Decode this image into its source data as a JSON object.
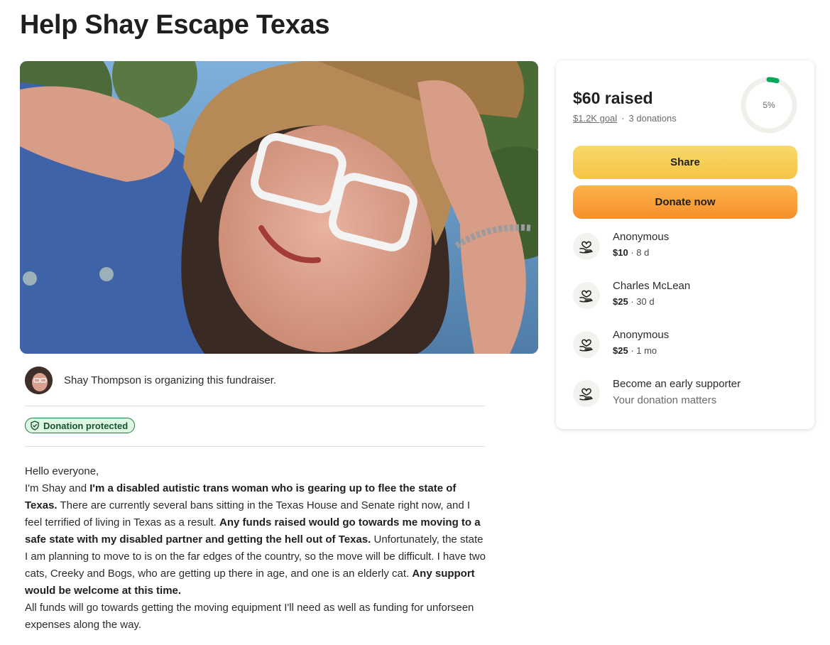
{
  "page": {
    "title": "Help Shay Escape Texas"
  },
  "organizer": {
    "text": "Shay Thompson is organizing this fundraiser."
  },
  "badge": {
    "label": "Donation protected"
  },
  "story": {
    "line1": "Hello everyone,",
    "p2_a": "I'm Shay and ",
    "p2_b": "I'm a disabled autistic trans woman who is gearing up to flee the state of Texas.",
    "p2_c": " There are currently several bans sitting in the Texas House and Senate right now, and I feel terrified of living in Texas as a result. ",
    "p2_d": "Any funds raised would go towards me moving to a safe state with my disabled partner and getting the hell out of Texas.",
    "p2_e": " Unfortunately, the state I am planning to move to is on the far edges of the country, so the move will be difficult. I have two cats, Creeky and Bogs, who are getting up there in age, and one is an elderly cat. ",
    "p2_f": "Any support would be welcome at this time.",
    "p3": "All funds will go towards getting the moving equipment I'll need as well as funding for unforseen expenses along the way."
  },
  "sidebar": {
    "raised": "$60 raised",
    "goal": "$1.2K goal",
    "separator": "·",
    "donations": "3 donations",
    "progress_label": "5%",
    "progress_fraction": 0.05,
    "share_label": "Share",
    "donate_label": "Donate now",
    "donors": [
      {
        "name": "Anonymous",
        "amount": "$10",
        "time": " · 8 d"
      },
      {
        "name": "Charles McLean",
        "amount": "$25",
        "time": " · 30 d"
      },
      {
        "name": "Anonymous",
        "amount": "$25",
        "time": " · 1 mo"
      }
    ],
    "early": {
      "title": "Become an early supporter",
      "subtitle": "Your donation matters"
    }
  },
  "colors": {
    "progress": "#02a95c",
    "share": "#f6cf56",
    "donate": "#f89c35",
    "badge_border": "#1c7a3d"
  },
  "icons": {
    "badge": "shield-check-icon",
    "donor": "heart-hands-icon"
  }
}
